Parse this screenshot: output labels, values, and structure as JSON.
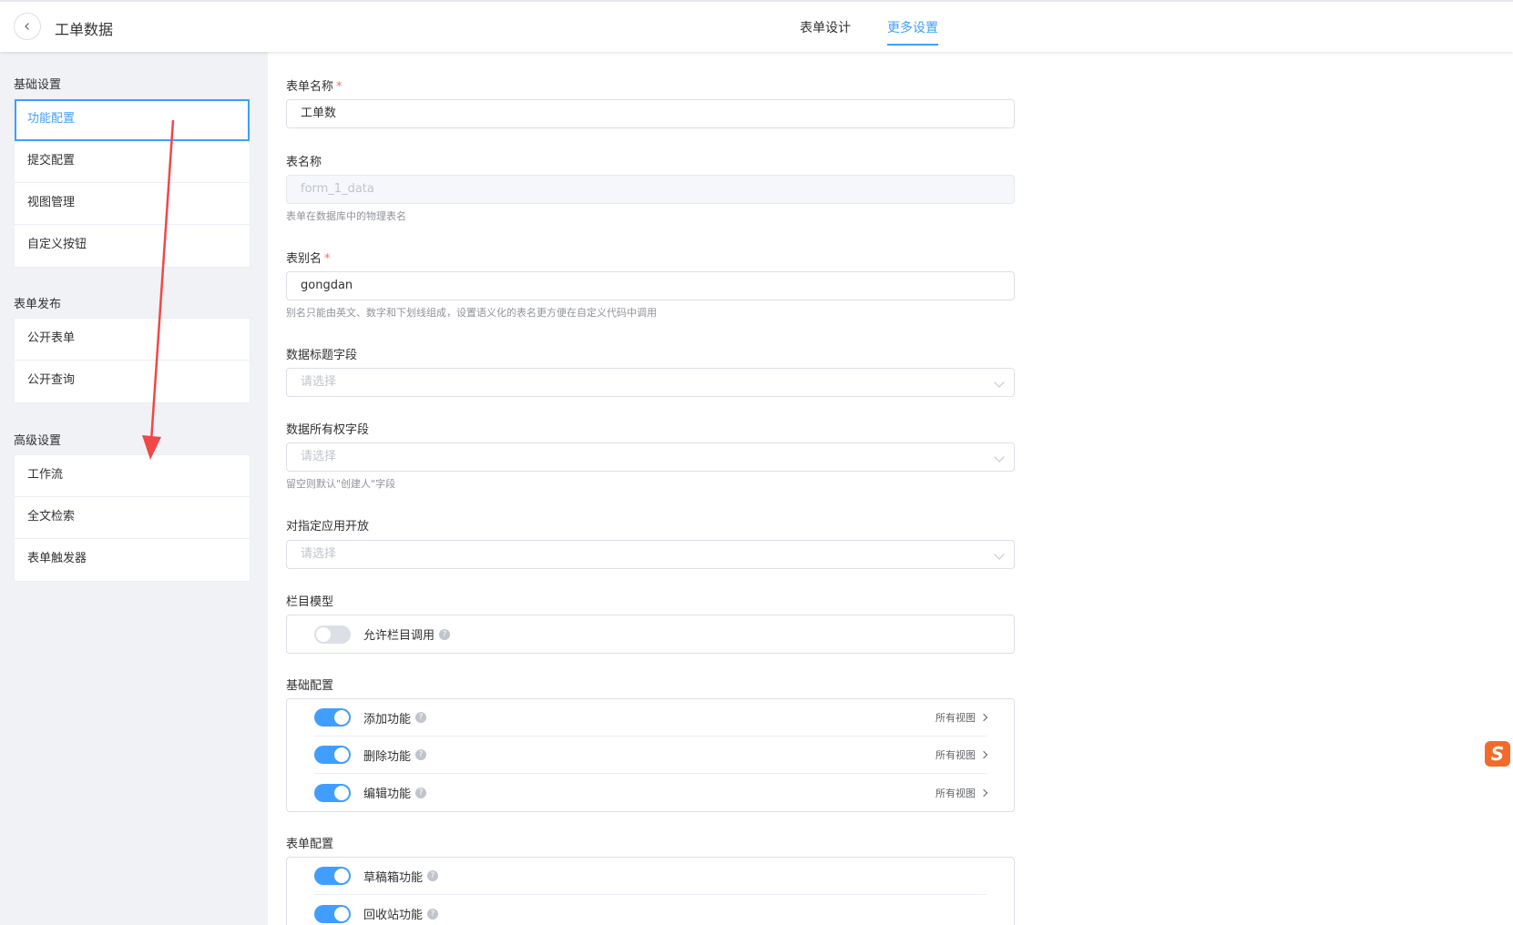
{
  "header": {
    "title": "工单数据",
    "tabs": [
      {
        "label": "表单设计",
        "active": false
      },
      {
        "label": "更多设置",
        "active": true
      }
    ]
  },
  "sidebar": {
    "groups": [
      {
        "title": "基础设置",
        "items": [
          "功能配置",
          "提交配置",
          "视图管理",
          "自定义按钮"
        ]
      },
      {
        "title": "表单发布",
        "items": [
          "公开表单",
          "公开查询"
        ]
      },
      {
        "title": "高级设置",
        "items": [
          "工作流",
          "全文检索",
          "表单触发器"
        ]
      }
    ],
    "active_item": "功能配置"
  },
  "form": {
    "form_name": {
      "label": "表单名称",
      "value": "工单数"
    },
    "table_name": {
      "label": "表名称",
      "value": "form_1_data",
      "hint": "表单在数据库中的物理表名"
    },
    "alias": {
      "label": "表别名",
      "value": "gongdan",
      "hint": "别名只能由英文、数字和下划线组成，设置语义化的表名更方便在自定义代码中调用"
    },
    "title_field": {
      "label": "数据标题字段",
      "placeholder": "请选择"
    },
    "owner_field": {
      "label": "数据所有权字段",
      "placeholder": "请选择",
      "hint": "留空则默认\"创建人\"字段"
    },
    "open_apps": {
      "label": "对指定应用开放",
      "placeholder": "请选择"
    },
    "column_model": {
      "label": "栏目模型",
      "switches": [
        {
          "label": "允许栏目调用",
          "on": false
        }
      ]
    },
    "basic_config": {
      "label": "基础配置",
      "switches": [
        {
          "label": "添加功能",
          "on": true,
          "link": "所有视图"
        },
        {
          "label": "删除功能",
          "on": true,
          "link": "所有视图"
        },
        {
          "label": "编辑功能",
          "on": true,
          "link": "所有视图"
        }
      ]
    },
    "form_config": {
      "label": "表单配置",
      "switches": [
        {
          "label": "草稿箱功能",
          "on": true
        },
        {
          "label": "回收站功能",
          "on": true
        }
      ]
    }
  },
  "icons": {
    "back": "chevron-left-icon",
    "select_caret": "chevron-down-icon",
    "help": "question-circle-icon",
    "row_link": "chevron-right-icon",
    "ime_logo": "sogou-s-icon"
  },
  "ime_logo_text": "S",
  "help_glyph": "?",
  "colors": {
    "accent": "#409eff",
    "required": "#f56c6c",
    "annotation_arrow": "#f04848"
  }
}
